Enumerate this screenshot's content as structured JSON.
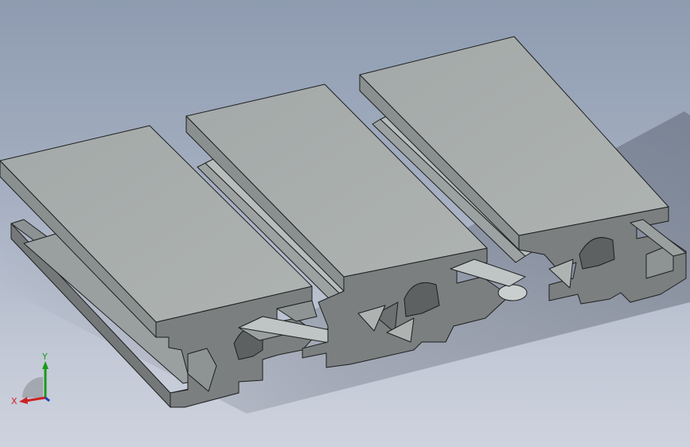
{
  "viewport": {
    "background_top": "#8e9bb0",
    "background_bottom": "#cdd2de"
  },
  "model": {
    "part": "aluminum-extrusion-profile",
    "slot_count": 3,
    "face_colors": {
      "top": "#a8adac",
      "front": "#7b7f80",
      "side": "#8f9494",
      "edge": "#1e1f1f"
    }
  },
  "triad": {
    "x_label": "X",
    "y_label": "Y",
    "x_color": "#cc2222",
    "y_color": "#1a9a1a",
    "z_color": "#1a3fbf"
  }
}
